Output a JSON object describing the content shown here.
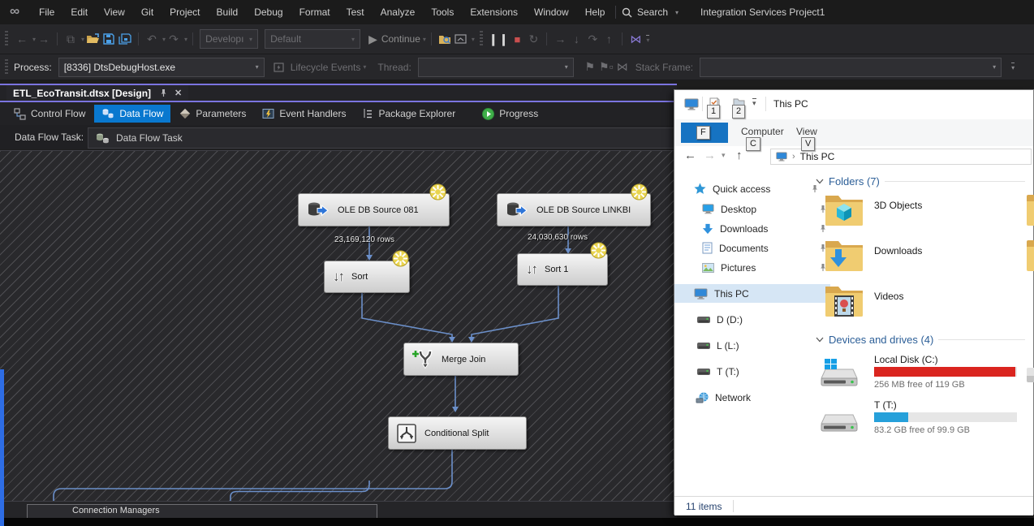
{
  "vs": {
    "menu": {
      "items": [
        "File",
        "Edit",
        "View",
        "Git",
        "Project",
        "Build",
        "Debug",
        "Format",
        "Test",
        "Analyze",
        "Tools",
        "Extensions",
        "Window",
        "Help"
      ],
      "search_label": "Search",
      "project_name": "Integration Services Project1"
    },
    "toolbar": {
      "config_combo": "Developı",
      "platform_combo": "Default",
      "continue_label": "Continue"
    },
    "debugbar": {
      "process_label": "Process:",
      "process_value": "[8336] DtsDebugHost.exe",
      "lifecycle_label": "Lifecycle Events",
      "thread_label": "Thread:",
      "stackframe_label": "Stack Frame:"
    },
    "doc_tab": {
      "title": "ETL_EcoTransit.dtsx [Design]"
    },
    "designer_tabs": {
      "control_flow": "Control Flow",
      "data_flow": "Data Flow",
      "parameters": "Parameters",
      "event_handlers": "Event Handlers",
      "package_explorer": "Package Explorer",
      "progress": "Progress"
    },
    "task_row": {
      "label": "Data Flow Task:",
      "value": "Data Flow Task"
    },
    "canvas": {
      "components": {
        "source1": "OLE DB Source 081",
        "source2": "OLE DB Source LINKBI",
        "sort1": "Sort",
        "sort2": "Sort 1",
        "merge": "Merge Join",
        "split": "Conditional Split"
      },
      "row_label1": "23,169,120 rows",
      "row_label2": "24,030,630 rows"
    },
    "connection_managers_label": "Connection Managers"
  },
  "explorer": {
    "window_title": "This PC",
    "keytips": {
      "file": "F",
      "qat1": "1",
      "qat2": "2",
      "computer": "C",
      "view": "V"
    },
    "ribbon": {
      "computer_tab": "Computer",
      "view_tab": "View"
    },
    "address": {
      "location": "This PC"
    },
    "nav": {
      "quick_access": "Quick access",
      "desktop": "Desktop",
      "downloads": "Downloads",
      "documents": "Documents",
      "pictures": "Pictures",
      "this_pc": "This PC",
      "drive_d": "D (D:)",
      "drive_l": "L (L:)",
      "drive_t": "T (T:)",
      "network": "Network"
    },
    "folders_group": {
      "header": "Folders (7)",
      "item1": "3D Objects",
      "item2": "Downloads",
      "item3": "Videos"
    },
    "drives_group": {
      "header": "Devices and drives (4)",
      "c_name": "Local Disk (C:)",
      "c_free": "256 MB free of 119 GB",
      "t_name": "T (T:)",
      "t_free": "83.2 GB free of 99.9 GB"
    },
    "status": "11 items"
  },
  "colors": {
    "vs_accent": "#007acc",
    "tab_purple": "#7b74e0",
    "bar_red": "#da251f",
    "bar_blue": "#26a0da",
    "connector": "#6b8fc9",
    "warn_badge": "#e9d44e"
  }
}
